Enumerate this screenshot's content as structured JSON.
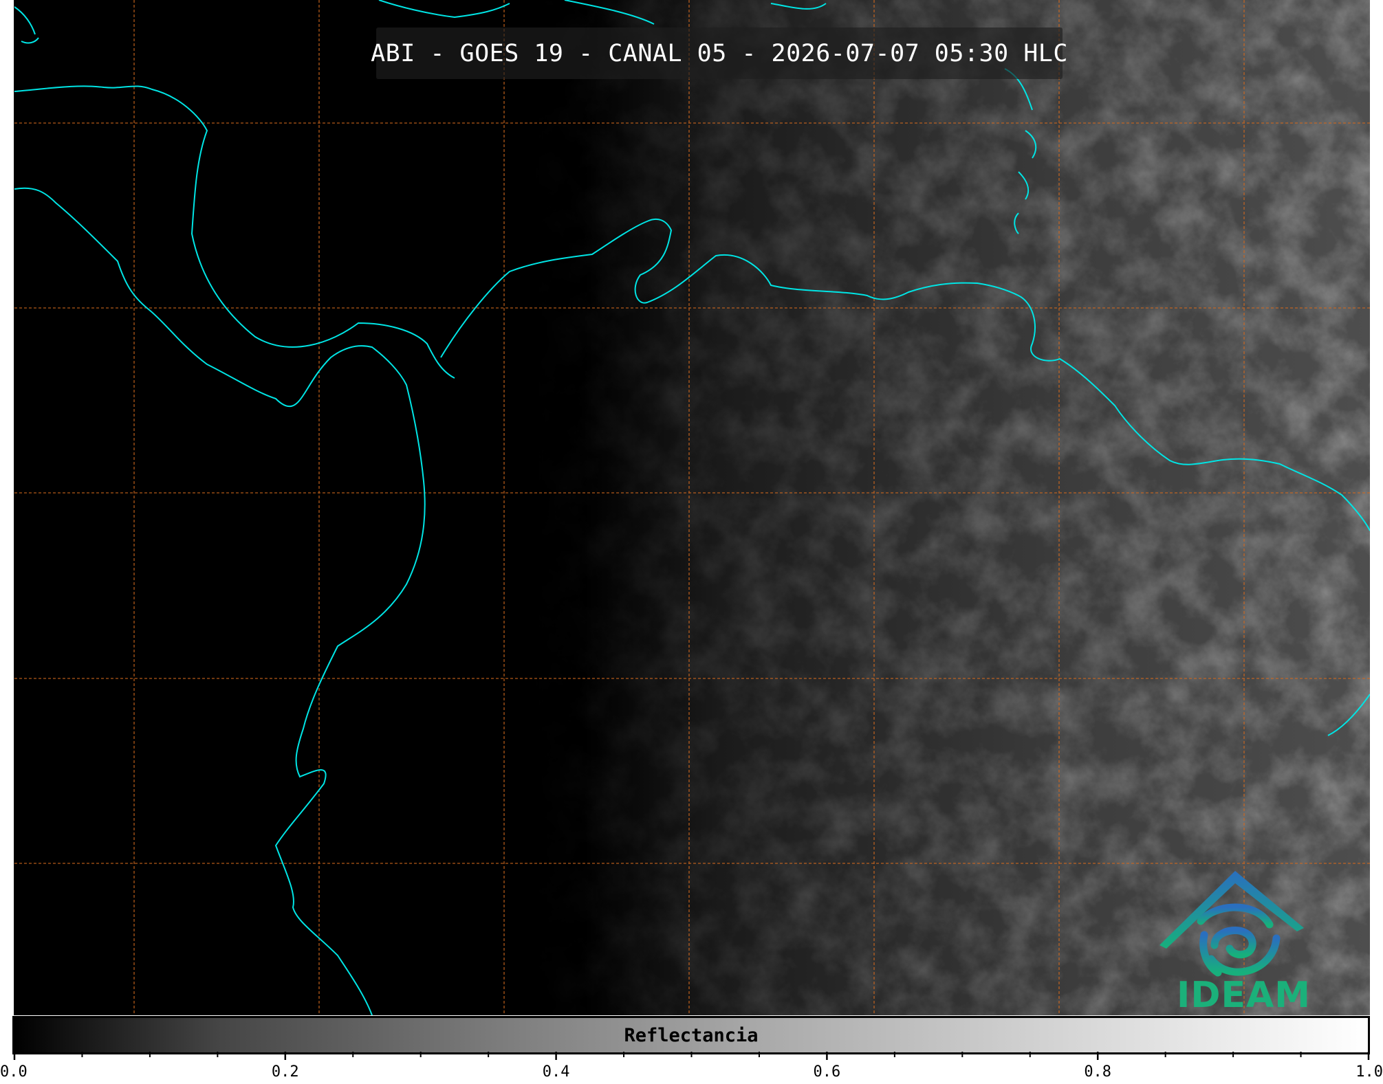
{
  "title": "ABI - GOES 19 - CANAL 05 - 2026-07-07 05:30 HLC",
  "colorbar": {
    "label": "Reflectancia",
    "min": 0.0,
    "max": 1.0,
    "tick_labels": [
      "0.0",
      "0.2",
      "0.4",
      "0.6",
      "0.8",
      "1.0"
    ],
    "minor_tick_step": 0.05
  },
  "logo": {
    "text": "IDEAM",
    "color_top": "#2a6fbf",
    "color_bottom": "#17b07c"
  },
  "map": {
    "coastline_color": "#00e5e5",
    "grid_color": "#d2691e",
    "background": "#000000"
  }
}
